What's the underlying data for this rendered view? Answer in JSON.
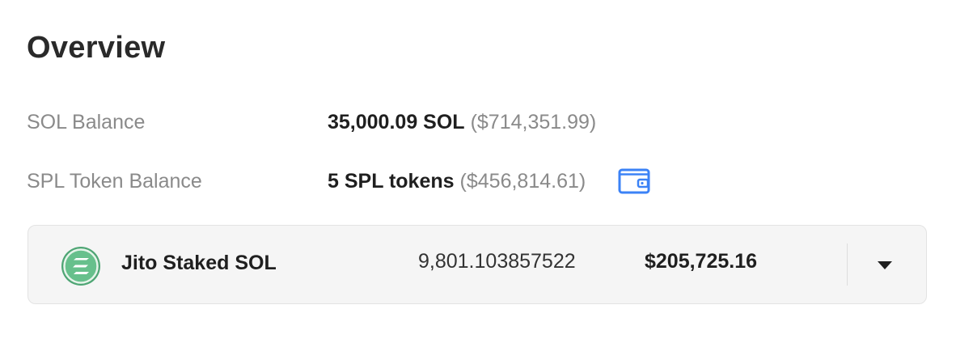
{
  "overview": {
    "title": "Overview"
  },
  "sol_balance": {
    "label": "SOL Balance",
    "amount": "35,000.09 SOL",
    "usd": "($714,351.99)"
  },
  "spl_balance": {
    "label": "SPL Token Balance",
    "amount": "5 SPL tokens",
    "usd": "($456,814.61)",
    "icon": "wallet-icon"
  },
  "token_list": {
    "items": [
      {
        "name": "Jito Staked SOL",
        "amount": "9,801.103857522",
        "usd_value": "$205,725.16",
        "icon": "jito-staked-sol-logo",
        "expand_icon": "caret-down-icon"
      }
    ]
  },
  "colors": {
    "accent": "#3b82f6",
    "token_logo": "#5fb882",
    "muted_text": "#8a8a8a",
    "card_bg": "#f5f5f5"
  }
}
